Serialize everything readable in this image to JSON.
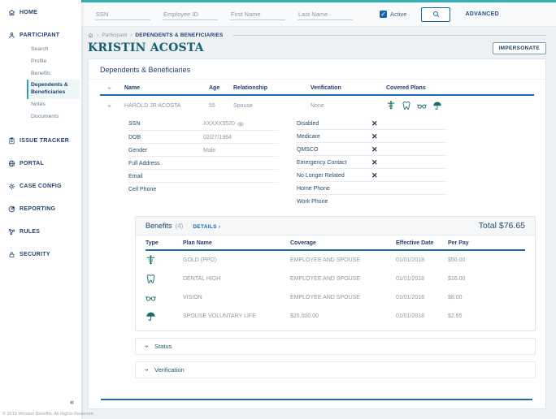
{
  "colors": {
    "accent_teal": "#35b0b4",
    "navy": "#1e3f6d",
    "link_blue": "#1566b0",
    "underline_blue": "#1b6ab2",
    "icon_teal": "#1c6b6f",
    "title_teal": "#17606f"
  },
  "sidebar": {
    "items": [
      {
        "label": "HOME",
        "icon": "home-icon"
      },
      {
        "label": "PARTICIPANT",
        "icon": "person-icon"
      },
      {
        "label": "ISSUE TRACKER",
        "icon": "clipboard-icon"
      },
      {
        "label": "PORTAL",
        "icon": "globe-icon"
      },
      {
        "label": "CASE CONFIG",
        "icon": "gear-icon"
      },
      {
        "label": "REPORTING",
        "icon": "pie-chart-icon"
      },
      {
        "label": "RULES",
        "icon": "nodes-icon"
      },
      {
        "label": "SECURITY",
        "icon": "lock-icon"
      }
    ],
    "participant_children": [
      {
        "label": "Search"
      },
      {
        "label": "Profile"
      },
      {
        "label": "Benefits"
      },
      {
        "label": "Dependents & Beneficiaries",
        "active": true
      },
      {
        "label": "Notes"
      },
      {
        "label": "Documents"
      }
    ]
  },
  "topbar": {
    "fields": [
      {
        "placeholder": "SSN"
      },
      {
        "placeholder": "Employee ID"
      },
      {
        "placeholder": "First Name"
      },
      {
        "placeholder": "Last Name"
      }
    ],
    "active_label": "Active",
    "active_checked": true,
    "advanced_label": "ADVANCED"
  },
  "breadcrumb": {
    "home": "home-icon",
    "items": [
      "Participant",
      "DEPENDENTS & BENEFICIARIES"
    ]
  },
  "page": {
    "title": "KRISTIN ACOSTA",
    "impersonate_label": "IMPERSONATE"
  },
  "panel": {
    "title": "Dependents & Beneficiaries",
    "table": {
      "headers": [
        "Name",
        "Age",
        "Relationship",
        "Verification",
        "Covered Plans"
      ],
      "row": {
        "name": "HAROLD JR ACOSTA",
        "age": "55",
        "relationship": "Spouse",
        "verification": "None",
        "covered_plans": [
          "medical",
          "dental",
          "vision",
          "life"
        ]
      }
    },
    "details": {
      "left": [
        {
          "label": "SSN",
          "value": "XXXXX5520",
          "has_eye": true
        },
        {
          "label": "DOB",
          "value": "02/27/1964"
        },
        {
          "label": "Gender",
          "value": "Male"
        },
        {
          "label": "Full Address",
          "value": ""
        },
        {
          "label": "Email",
          "value": ""
        },
        {
          "label": "Cell Phone",
          "value": ""
        }
      ],
      "right": [
        {
          "label": "Disabled",
          "value": "✕"
        },
        {
          "label": "Medicare",
          "value": "✕"
        },
        {
          "label": "QMSCO",
          "value": "✕"
        },
        {
          "label": "Emergency Contact",
          "value": "✕"
        },
        {
          "label": "No Longer Related",
          "value": "✕"
        },
        {
          "label": "Home Phone",
          "value": ""
        },
        {
          "label": "Work Phone",
          "value": ""
        }
      ]
    },
    "benefits": {
      "title": "Benefits",
      "count": "(4)",
      "details_label": "DETAILS ›",
      "total_label": "Total $76.65",
      "headers": [
        "Type",
        "Plan Name",
        "Coverage",
        "Effective Date",
        "Per Pay"
      ],
      "rows": [
        {
          "type": "medical",
          "plan": "GOLD (PPO)",
          "coverage": "EMPLOYEE AND SPOUSE",
          "effective": "01/01/2018",
          "per_pay": "$50.00"
        },
        {
          "type": "dental",
          "plan": "DENTAL HIGH",
          "coverage": "EMPLOYEE AND SPOUSE",
          "effective": "01/01/2018",
          "per_pay": "$16.00"
        },
        {
          "type": "vision",
          "plan": "VISION",
          "coverage": "EMPLOYEE AND SPOUSE",
          "effective": "01/01/2018",
          "per_pay": "$8.00"
        },
        {
          "type": "life",
          "plan": "SPOUSE VOLUNTARY LIFE",
          "coverage": "$25,000.00",
          "effective": "01/01/2018",
          "per_pay": "$2.65"
        }
      ]
    },
    "collapsibles": [
      {
        "label": "Status"
      },
      {
        "label": "Verification"
      }
    ]
  },
  "footer": {
    "copyright": "© 2019 Winston Benefits. All Rights Reserved."
  }
}
